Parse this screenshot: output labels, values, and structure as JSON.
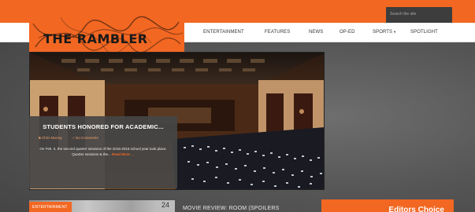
{
  "colors": {
    "accent": "#f26722",
    "nav_bg": "#ffffff",
    "caption_bg": "#464646"
  },
  "header": {
    "search_placeholder": "Search the site",
    "logo_text": "THE RAMBLER"
  },
  "nav": {
    "items": [
      {
        "label": "ENTERTAINMENT"
      },
      {
        "label": "FEATURES"
      },
      {
        "label": "NEWS"
      },
      {
        "label": "OP-ED"
      },
      {
        "label": "SPORTS"
      },
      {
        "label": "SPOTLIGHT"
      }
    ],
    "dropdown_icon": "caret-down-icon"
  },
  "featured": {
    "title": "STUDENTS HONORED FOR ACADEMIC...",
    "author": "Chris Murray",
    "comments": "No Comments",
    "excerpt": "On Feb. 5, the second quarter sessions of the 2015-2016 school year took place. Quarter sessions & the...",
    "read_more": "Read More →"
  },
  "bottom": {
    "category": "ENTERTAINMENT",
    "date_day": "24",
    "headline": "MOVIE REVIEW: ROOM (SPOILERS",
    "editors_choice": "Editors Choice"
  }
}
